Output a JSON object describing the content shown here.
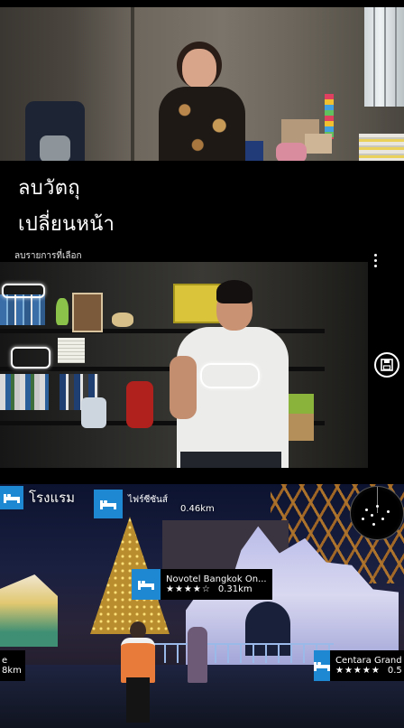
{
  "menu": {
    "remove_object": "ลบวัตถุ",
    "change_face": "เปลี่ยนหน้า",
    "section_label": "ลบรายการที่เลือก"
  },
  "ar_view": {
    "category": "โรงแรม",
    "pois": [
      {
        "name": "ไฟร์ซีซันส์",
        "distance": "0.46km"
      },
      {
        "name": "Novotel Bangkok On...",
        "stars": "★★★★☆",
        "distance": "0.31km"
      },
      {
        "name": "Centara Grand",
        "stars": "★★★★★",
        "distance": "0.5"
      },
      {
        "name": "e",
        "distance": "8km"
      }
    ]
  },
  "icons": {
    "more": "more-vertical-icon",
    "save": "save-icon",
    "hotel": "bed-icon",
    "radar": "radar-icon"
  },
  "colors": {
    "accent": "#1e88d2",
    "background": "#000000",
    "text": "#ffffff"
  }
}
